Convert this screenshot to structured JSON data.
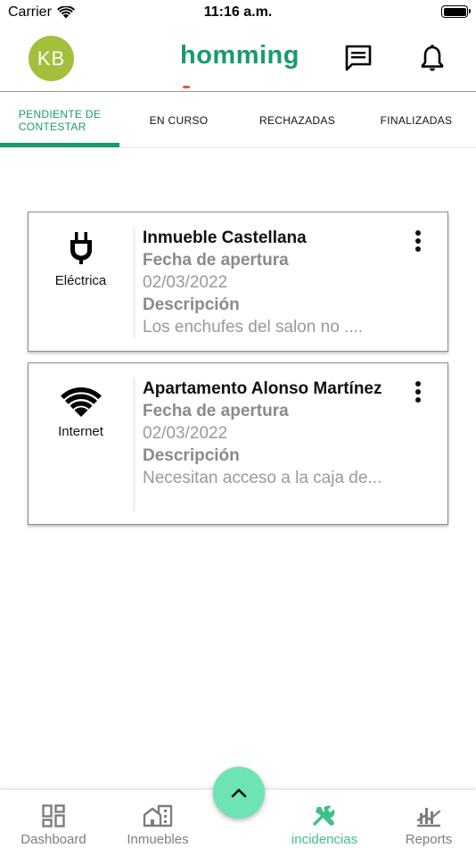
{
  "status_bar": {
    "carrier": "Carrier",
    "time": "11:16 a.m."
  },
  "header": {
    "avatar_initials": "KB",
    "logo_text": "homming",
    "icons": {
      "chat": "chat-icon",
      "notifications": "bell-icon"
    },
    "colors": {
      "brand": "#1a9a6c",
      "avatar": "#a3bf3b"
    }
  },
  "tabs": [
    {
      "label": "PENDIENTE DE\nCONTESTAR",
      "active": true
    },
    {
      "label": "EN CURSO",
      "active": false
    },
    {
      "label": "RECHAZADAS",
      "active": false
    },
    {
      "label": "FINALIZADAS",
      "active": false
    }
  ],
  "incidents": [
    {
      "category_icon": "plug-icon",
      "category": "Eléctrica",
      "property": "Inmueble Castellana",
      "date_label": "Fecha de apertura",
      "date": "02/03/2022",
      "description_label": "Descripción",
      "description": "Los enchufes del salon no ...."
    },
    {
      "category_icon": "wifi-icon",
      "category": "Internet",
      "property": "Apartamento Alonso Martínez",
      "date_label": "Fecha de apertura",
      "date": "02/03/2022",
      "description_label": "Descripción",
      "description": "Necesitan acceso a la caja de..."
    }
  ],
  "fab": {
    "icon": "chevron-up-icon",
    "color": "#6ee3b3"
  },
  "bottom_nav": [
    {
      "icon": "dashboard-icon",
      "label": "Dashboard",
      "active": false
    },
    {
      "icon": "buildings-icon",
      "label": "Inmuebles",
      "active": false
    },
    {
      "icon": "tools-icon",
      "label": "incidencias",
      "active": true
    },
    {
      "icon": "reports-icon",
      "label": "Reports",
      "active": false
    }
  ]
}
